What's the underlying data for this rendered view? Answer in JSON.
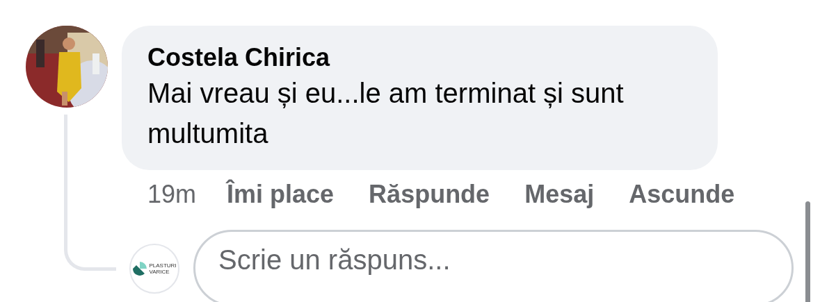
{
  "comment": {
    "author": "Costela Chirica",
    "text": "Mai vreau și eu...le am terminat și sunt multumita"
  },
  "actions": {
    "time": "19m",
    "buttons": [
      "Îmi place",
      "Răspunde",
      "Mesaj",
      "Ascunde"
    ]
  },
  "reply_box": {
    "avatar_lines": [
      "PLASTURI",
      "VARICE"
    ],
    "placeholder": "Scrie un răspuns..."
  }
}
